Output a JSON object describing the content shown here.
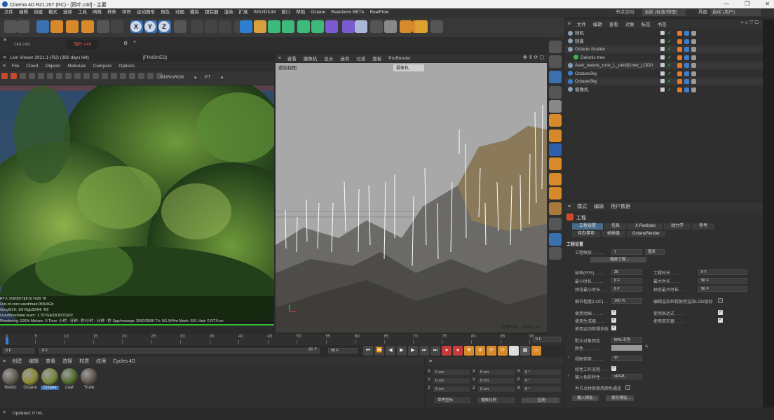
{
  "window": {
    "title": "Cinema 4D R21.207 (RC) - [雨叶.c4d] - 主要",
    "controls": [
      "—",
      "❐",
      "✕"
    ]
  },
  "menubar": {
    "items": [
      "文件",
      "编辑",
      "创建",
      "模式",
      "选择",
      "工具",
      "网格",
      "样条",
      "体积",
      "运动图形",
      "角色",
      "动画",
      "模拟",
      "跟踪器",
      "渲染",
      "扩展",
      "INSYDIUM",
      "窗口",
      "帮助",
      "Octane",
      "Reactions BETA",
      "RealFlow"
    ],
    "node_space_label": "节点空间:",
    "node_space_value": "当前 (标准/物理)",
    "layout_label": "界面:",
    "layout_value": "启动 (用户)"
  },
  "tabs": {
    "items": [
      "c4d.c4d",
      "雨叶.c4d"
    ],
    "add": "+",
    "active": 1
  },
  "live_viewer": {
    "title": "Live Viewer 2021.1-(R2) (366 days left)",
    "status": "[FINISHED]",
    "menu": [
      "File",
      "Cloud",
      "Objects",
      "Materials",
      "Compare",
      "Options"
    ],
    "color_mode": "HDR/sRGB",
    "pt_mode": "PT",
    "stats": [
      "RTX 3090[DT][8.6]        %98      78",
      "Out-of-core used/max:0Kb/4Gb",
      "Grey8/16: 1/0            Rgb32/64: 4/2",
      "Used/free/total vram: 1.707Gb/18.837Gb/2",
      "Rendering: 100%   Ms/sec: 0   Time: 小时 : 分钟 : 秒/小时 : 分钟 : 秒   Spp/maxspp: 3500/3500  Tri: 0/1.944m  Mesh: 501  Hair: 0   RTX:on"
    ]
  },
  "viewport": {
    "menu": [
      "查看",
      "摄像机",
      "显示",
      "选项",
      "过滤",
      "面板",
      "ProRender"
    ],
    "label": "透视视图",
    "camera_label": "摄像机",
    "grid_label": "网格间距 : 10000 cm"
  },
  "object_manager": {
    "menu": [
      "文件",
      "编辑",
      "查看",
      "对象",
      "标签",
      "书签"
    ],
    "rows": [
      {
        "name": "随机",
        "indent": 0,
        "color": "#c8c8c8"
      },
      {
        "name": "随着",
        "indent": 0,
        "color": "#c8c8c8"
      },
      {
        "name": "Octane Scatter",
        "indent": 0,
        "color": "#c8c8c8"
      },
      {
        "name": "Delonix tree",
        "indent": 1,
        "color": "#c8c8c8"
      },
      {
        "name": "Aset_nature_rock_L_ukoifj1mw_LOD0",
        "indent": 0,
        "color": "#c8c8c8"
      },
      {
        "name": "OctaneSky",
        "indent": 0,
        "color": "#c8c8c8"
      },
      {
        "name": "OctaneSky",
        "indent": 0,
        "color": "#c8c8c8"
      },
      {
        "name": "摄像机",
        "indent": 0,
        "color": "#c8c8c8"
      }
    ]
  },
  "attributes": {
    "menu": [
      "模式",
      "编辑",
      "用户数据"
    ],
    "title": "工程",
    "tabs": [
      "工程设置",
      "信息",
      "X-Particles",
      "动力学",
      "参考"
    ],
    "subtabs": [
      "待办事项",
      "帧插值",
      "OctaneRender"
    ],
    "section": "工程设置",
    "fields": {
      "scale_label": "工程缩放 . . . . .",
      "scale_value": "1",
      "scale_unit": "厘米",
      "scale_button": "缩放工程...",
      "fps_label": "帧率(FPS) . . . .",
      "fps_value": "30",
      "duration_label": "工程时长 . . . . .",
      "duration_value": "0 F",
      "min_label": "最小时长 . . . . .",
      "min_value": "0 F",
      "max_label": "最大时长 . . . . .",
      "max_value": "90 F",
      "pmin_label": "预览最小时长. . .",
      "pmin_value": "0 F",
      "pmax_label": "预览最大时长. . .",
      "pmax_value": "90 F",
      "lod_label": "细节程度(LOD) . .",
      "lod_value": "100 %",
      "lod_render_label": "编辑渲染检视使用渲染LOD级别",
      "anim_label": "使用动画 . . . . .",
      "expr_label": "使用表达式 . . . .",
      "gen_label": "使用生成器 . . . .",
      "deform_label": "使用变形器 . . . .",
      "motion_label": "使用运动剪辑系统",
      "default_color_label": "默认对象颜色 . .",
      "default_color_value": "60% 灰色",
      "color_label": "颜色 . . . . . . . .",
      "view_clip_label": "视图修剪 . . . . .",
      "view_clip_value": "中",
      "linear_label": "线性工作流程 . . .",
      "input_color_label": "输入色彩特性 . . .",
      "input_color_value": "sRGB",
      "node_color_label": "为节点材质使用颜色通道",
      "load_preset": "载入预设...",
      "save_preset": "保存预设..."
    }
  },
  "timeline": {
    "ticks": [
      "0",
      "5",
      "10",
      "15",
      "20",
      "25",
      "30",
      "35",
      "40",
      "45",
      "50",
      "55",
      "60",
      "65",
      "70",
      "75",
      "80",
      "85",
      "90"
    ],
    "current": "0 F",
    "start": "0 F",
    "start2": "0 F",
    "end": "90 F",
    "end2": "90 F"
  },
  "materials": {
    "menu": [
      "创建",
      "编辑",
      "查看",
      "选择",
      "材质",
      "纹理",
      "Cycles 4D"
    ],
    "items": [
      {
        "name": "Nordic",
        "color": "#5f5a4f"
      },
      {
        "name": "Octane",
        "color": "#8a8a33"
      },
      {
        "name": "Octane",
        "color": "#77853a"
      },
      {
        "name": "Leaf",
        "color": "#4f6a2a"
      },
      {
        "name": "Trunk",
        "color": "#5a5049"
      }
    ],
    "active": 2
  },
  "coordinates": {
    "rows": [
      {
        "a": "X",
        "av": "0 cm",
        "b": "X",
        "bv": "0 cm",
        "c": "H",
        "cv": "0 °"
      },
      {
        "a": "Y",
        "av": "0 cm",
        "b": "Y",
        "bv": "0 cm",
        "c": "P",
        "cv": "0 °"
      },
      {
        "a": "Z",
        "av": "0 cm",
        "b": "Z",
        "bv": "0 cm",
        "c": "B",
        "cv": "0 °"
      }
    ],
    "mode1": "世界坐标",
    "mode2": "缩放比例",
    "apply": "应用"
  },
  "status": {
    "text": "Updated: 0 ms."
  }
}
